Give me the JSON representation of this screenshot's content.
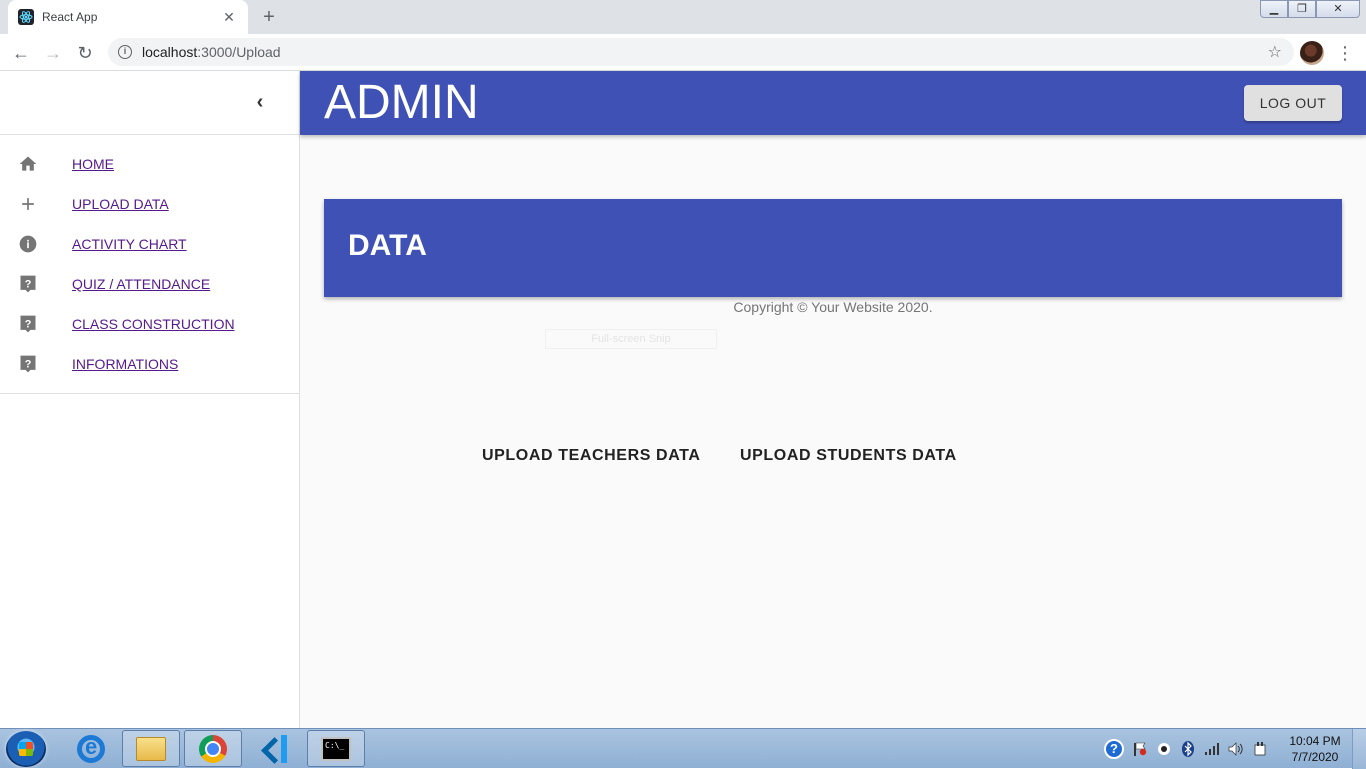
{
  "browser": {
    "tab_title": "React App",
    "url_host": "localhost",
    "url_port_path": ":3000/Upload"
  },
  "appbar": {
    "brand": "ADMIN",
    "logout_label": "LOG OUT"
  },
  "sidebar": {
    "items": [
      {
        "label": "HOME",
        "icon": "home-icon"
      },
      {
        "label": "UPLOAD DATA",
        "icon": "plus-icon"
      },
      {
        "label": "ACTIVITY CHART",
        "icon": "info-icon"
      },
      {
        "label": "QUIZ / ATTENDANCE",
        "icon": "help-icon"
      },
      {
        "label": "CLASS CONSTRUCTION",
        "icon": "help-icon"
      },
      {
        "label": "INFORMATIONS",
        "icon": "help-icon"
      }
    ]
  },
  "main": {
    "banner_title": "DATA",
    "copyright": "Copyright © Your Website 2020.",
    "snip_overlay": "Full-screen Snip",
    "upload_teachers_label": "UPLOAD TEACHERS DATA",
    "upload_students_label": "UPLOAD STUDENTS DATA"
  },
  "taskbar": {
    "time": "10:04 PM",
    "date": "7/7/2020"
  },
  "colors": {
    "primary": "#3f51b5",
    "link": "#551a8b"
  }
}
